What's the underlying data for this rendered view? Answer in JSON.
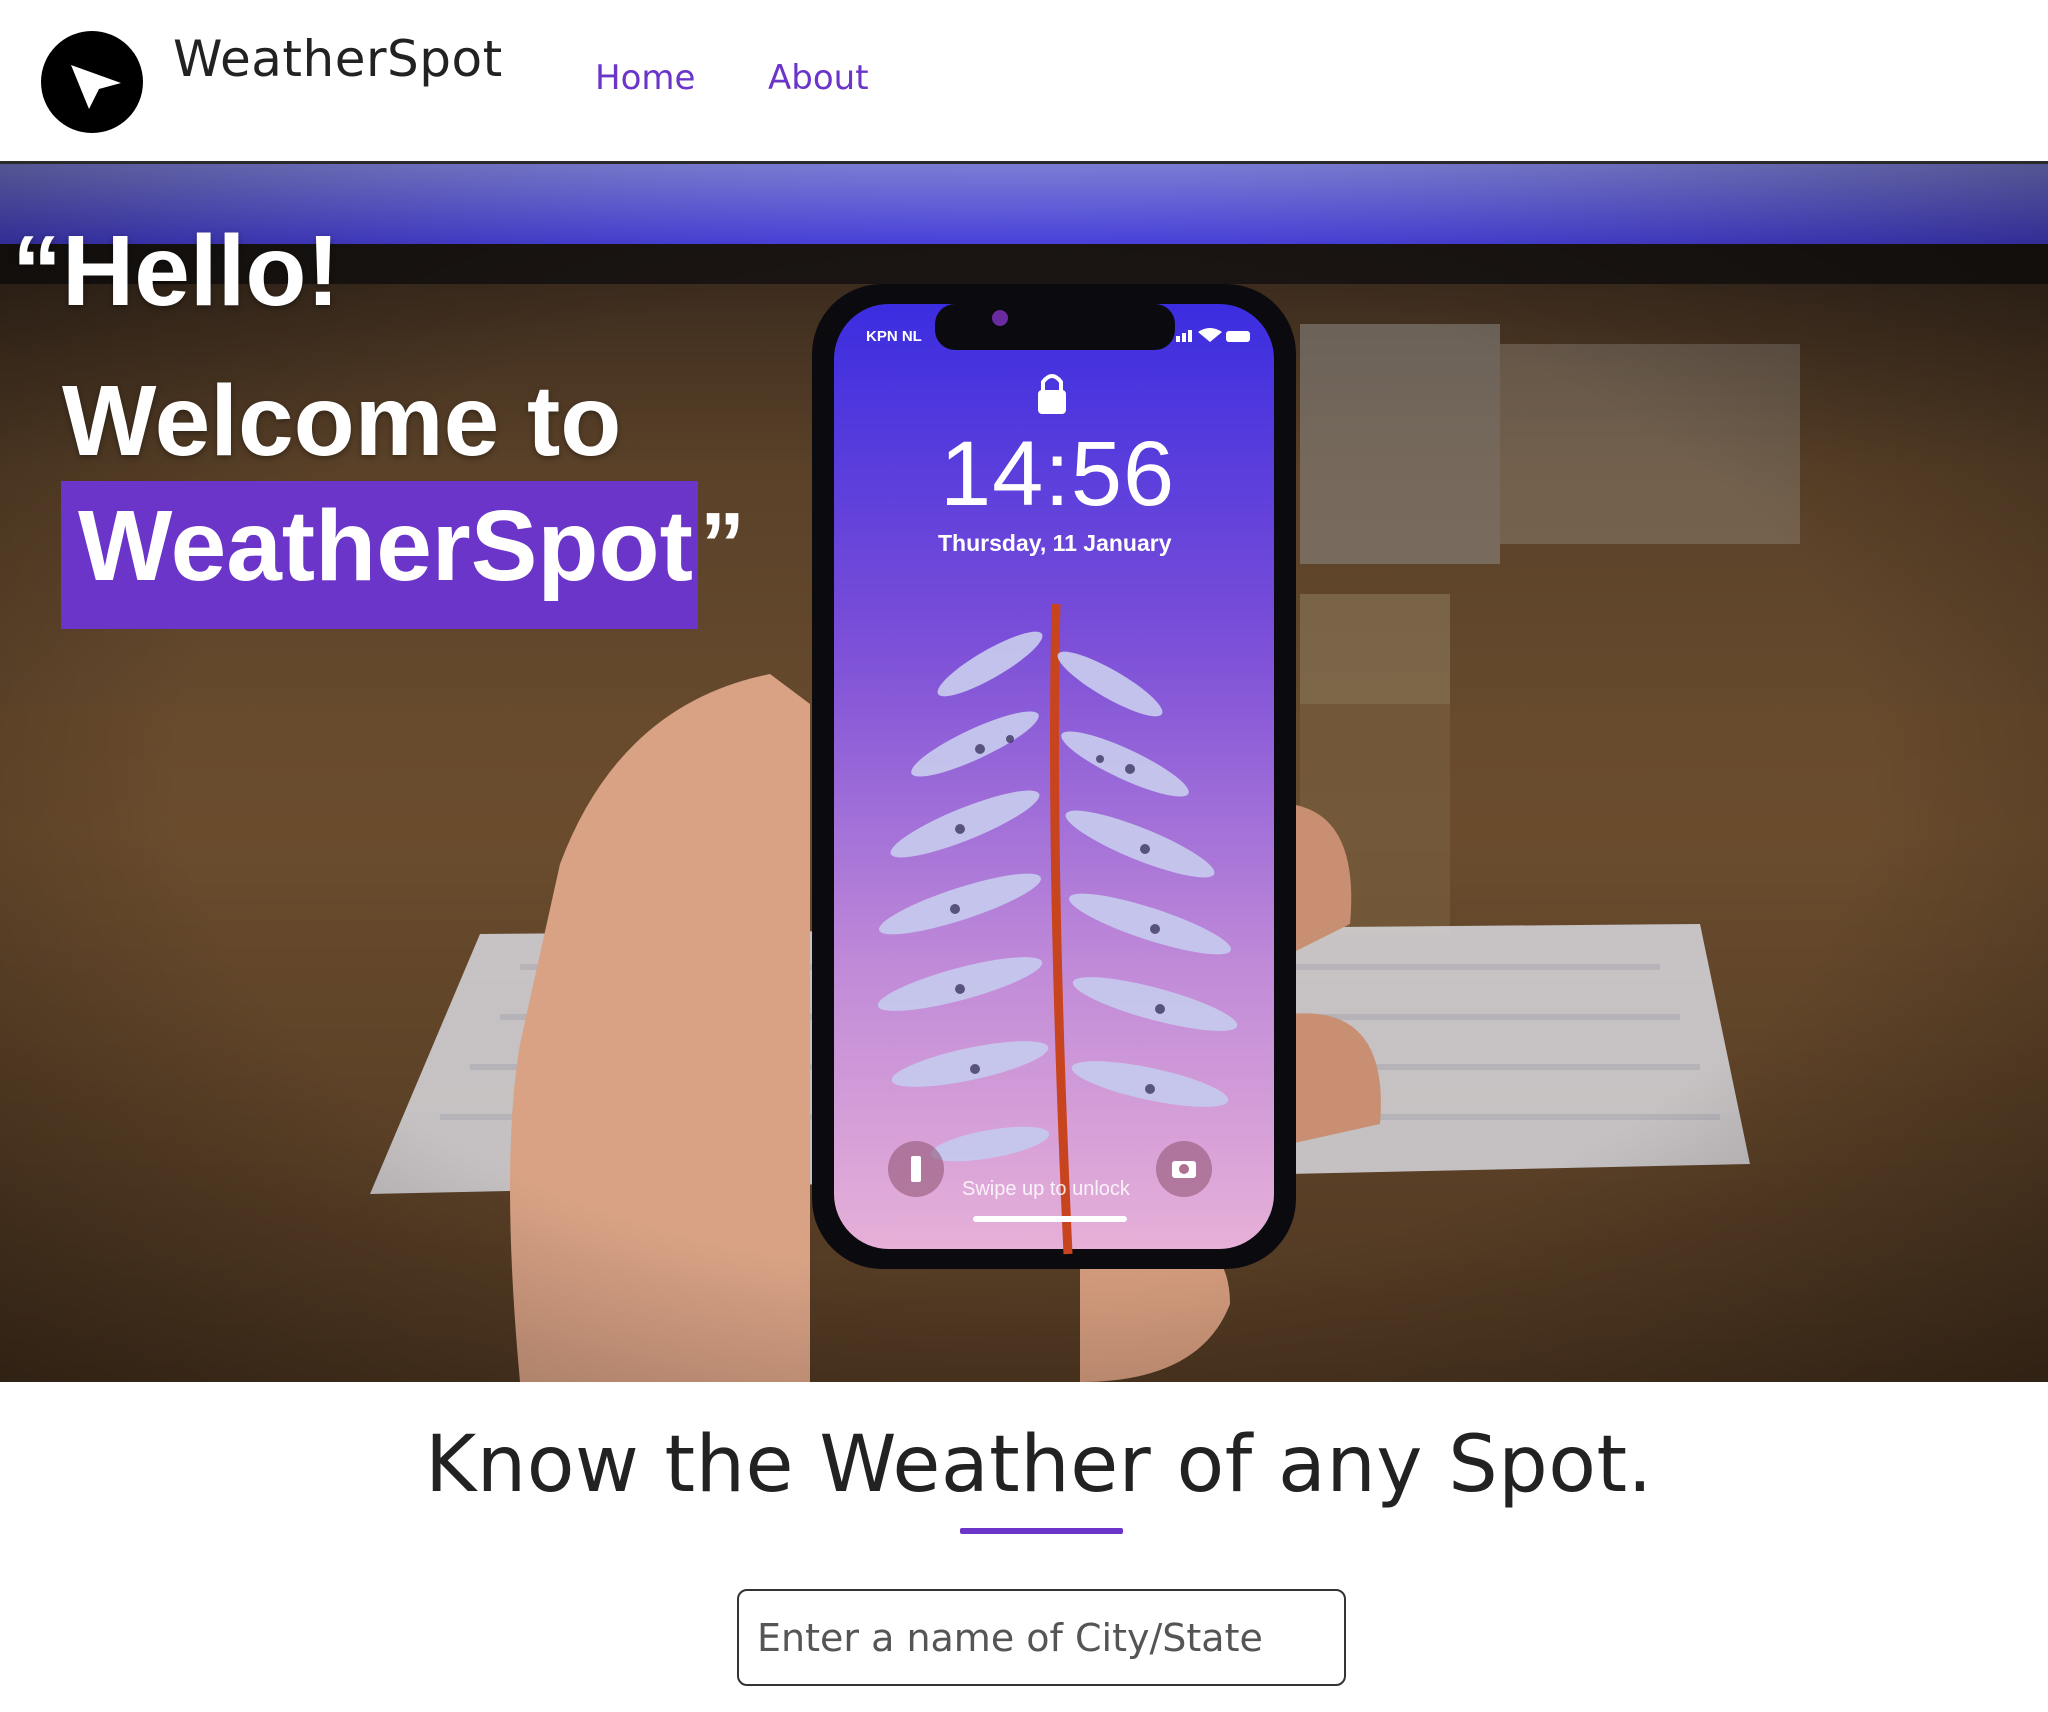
{
  "navbar": {
    "logo_icon": "navigation-arrow-icon",
    "brand": "WeatherSpot",
    "links": [
      "Home",
      "About"
    ]
  },
  "hero": {
    "line1": "“Hello!",
    "line2": "Welcome to",
    "highlight": "WeatherSpot",
    "close_quote": "”",
    "phone": {
      "carrier": "KPN NL",
      "time": "14:56",
      "date": "Thursday, 11 January",
      "swipe_hint": "Swipe up to unlock",
      "icons": [
        "lock-icon",
        "flashlight-icon",
        "camera-icon",
        "signal-icon",
        "wifi-icon",
        "battery-icon"
      ]
    }
  },
  "main": {
    "tagline": "Know the Weather of any Spot.",
    "search_placeholder": "Enter a name of City/State"
  },
  "colors": {
    "accent": "#6a35c8",
    "text": "#222222",
    "background": "#ffffff"
  }
}
